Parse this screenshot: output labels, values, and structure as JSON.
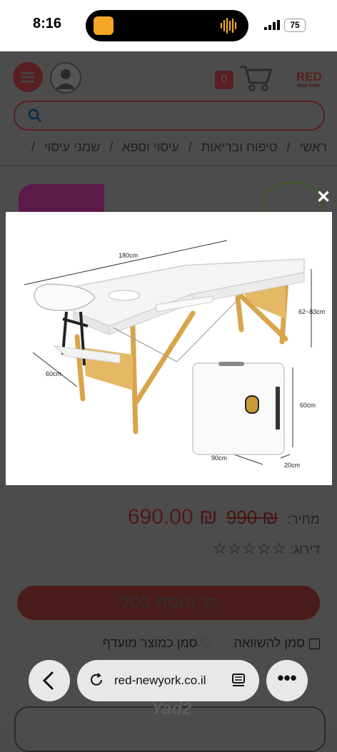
{
  "status_bar": {
    "time": "8:16",
    "battery": "75"
  },
  "header": {
    "cart_count": "0",
    "logo_text": "RED",
    "logo_sub": "NEW YORK"
  },
  "search": {
    "placeholder": ""
  },
  "breadcrumbs": [
    "ראשי",
    "טיפוח ובריאות",
    "עיסוי וספא",
    "שמני עיסוי"
  ],
  "breadcrumb_separator": "/",
  "product_image": {
    "dim_length": "180cm",
    "dim_height": "62~83cm",
    "dim_width": "60cm",
    "case_height": "60cm",
    "case_width": "90cm",
    "case_depth": "20cm"
  },
  "product": {
    "price_label": "מחיר:",
    "price_old": "₪ 990",
    "price_new": "₪ 690.00",
    "rating_label": "דירוג:",
    "stars": "☆☆☆☆☆",
    "add_to_cart": "הוסף לסל",
    "compare_label": "סמן להשוואה",
    "favorite_label": "סמן כמוצר מועדף"
  },
  "browser": {
    "url": "red-newyork.co.il",
    "more": "•••"
  },
  "watermark": "Yad2",
  "close_symbol": "✕",
  "colors": {
    "brand_red": "#c21e2a",
    "overlay": "#4c4c4c"
  }
}
